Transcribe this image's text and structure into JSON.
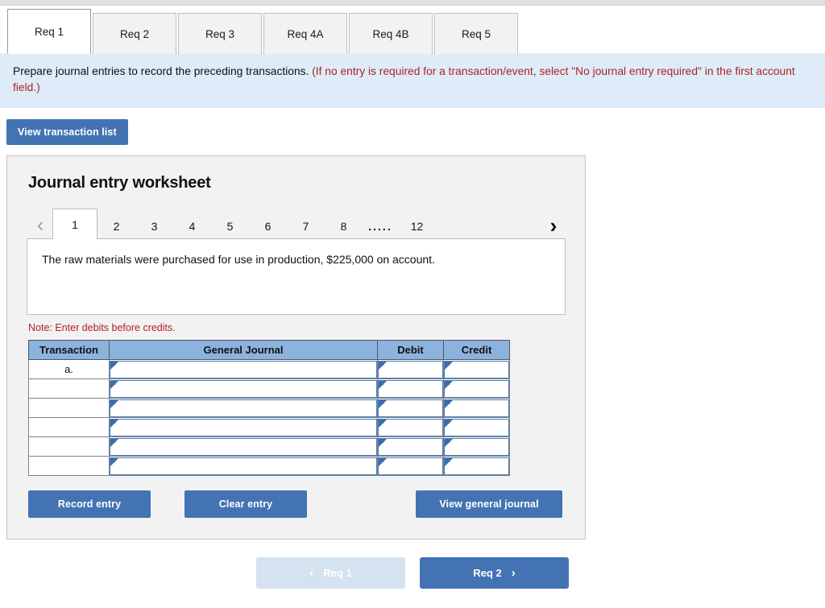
{
  "tabs": [
    {
      "label": "Req 1",
      "active": true
    },
    {
      "label": "Req 2",
      "active": false
    },
    {
      "label": "Req 3",
      "active": false
    },
    {
      "label": "Req 4A",
      "active": false
    },
    {
      "label": "Req 4B",
      "active": false
    },
    {
      "label": "Req 5",
      "active": false
    }
  ],
  "instruction": {
    "main": "Prepare journal entries to record the preceding transactions.",
    "hint": "(If no entry is required for a transaction/event, select \"No journal entry required\" in the first account field.)"
  },
  "toolbar": {
    "view_transaction_list_label": "View transaction list"
  },
  "worksheet": {
    "title": "Journal entry worksheet",
    "pager": {
      "prev_icon": "‹",
      "next_icon": "›",
      "pages": [
        "1",
        "2",
        "3",
        "4",
        "5",
        "6",
        "7",
        "8",
        ".....",
        "12"
      ],
      "active_page": "1"
    },
    "description": "The raw materials were purchased for use in production, $225,000 on account.",
    "note": "Note: Enter debits before credits.",
    "table": {
      "headers": [
        "Transaction",
        "General Journal",
        "Debit",
        "Credit"
      ],
      "rows": [
        {
          "transaction": "a.",
          "general_journal": "",
          "debit": "",
          "credit": ""
        },
        {
          "transaction": "",
          "general_journal": "",
          "debit": "",
          "credit": ""
        },
        {
          "transaction": "",
          "general_journal": "",
          "debit": "",
          "credit": ""
        },
        {
          "transaction": "",
          "general_journal": "",
          "debit": "",
          "credit": ""
        },
        {
          "transaction": "",
          "general_journal": "",
          "debit": "",
          "credit": ""
        },
        {
          "transaction": "",
          "general_journal": "",
          "debit": "",
          "credit": ""
        }
      ]
    },
    "actions": {
      "record_entry_label": "Record entry",
      "clear_entry_label": "Clear entry",
      "view_general_journal_label": "View general journal"
    }
  },
  "footer": {
    "prev_label": "Req 1",
    "prev_icon": "‹",
    "prev_disabled": true,
    "next_label": "Req 2",
    "next_icon": "›"
  },
  "colors": {
    "accent_blue": "#4373b3",
    "disabled_blue": "#d5e2f0",
    "table_header_blue": "#8cb2de",
    "banner_blue": "#ddecf8",
    "hint_red": "#b32026",
    "panel_gray": "#f2f2f2"
  }
}
